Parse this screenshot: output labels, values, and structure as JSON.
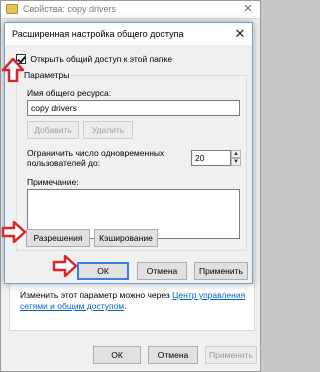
{
  "background_window": {
    "title": "Свойства: copy drivers",
    "notice_text": "Изменить этот параметр можно через ",
    "notice_link": "Центр управления сетями и общим доступом",
    "notice_end": ".",
    "buttons": {
      "ok": "ОК",
      "cancel": "Отмена",
      "apply": "Применить"
    }
  },
  "dialog": {
    "title": "Расширенная настройка общего доступа",
    "share_checkbox": {
      "label": "Открыть общий доступ к этой папке",
      "checked": true
    },
    "group_label": "Параметры",
    "share_name_label": "Имя общего ресурса:",
    "share_name_value": "copy drivers",
    "add_button": "Добавить",
    "remove_button": "Удалить",
    "limit_label_line1": "Ограничить число одновременных",
    "limit_label_line2": "пользователей до:",
    "limit_value": "20",
    "comment_label": "Примечание:",
    "comment_value": "",
    "permissions_button": "Разрешения",
    "caching_button": "Кэширование",
    "ok_button": "ОК",
    "cancel_button": "Отмена",
    "apply_button": "Применить"
  },
  "colors": {
    "annotation_red": "#d9262b",
    "link_blue": "#0066cc",
    "default_button_border": "#3c7fd6"
  }
}
